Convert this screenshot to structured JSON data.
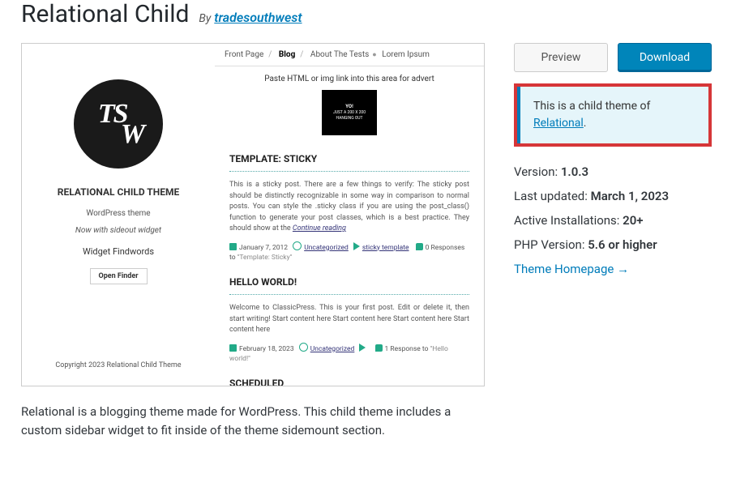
{
  "header": {
    "title": "Relational Child",
    "by": "By",
    "author": "tradesouthwest"
  },
  "screenshot": {
    "theme_name": "RELATIONAL CHILD THEME",
    "subtitle1": "WordPress theme",
    "subtitle2": "Now with sideout widget",
    "widget_label": "Widget Findwords",
    "open_finder": "Open Finder",
    "copyright": "Copyright 2023 Relational Child Theme",
    "nav": {
      "front": "Front Page",
      "blog": "Blog",
      "about": "About The Tests",
      "lorem": "Lorem Ipsum"
    },
    "ad_hint": "Paste HTML or img link into this area for advert",
    "ad_box": {
      "line1": "YO!",
      "line2": "JUST A 200 X 200",
      "line3": "HANGING OUT"
    },
    "post1": {
      "title": "TEMPLATE: STICKY",
      "body": "This is a sticky post. There are a few things to verify: The sticky post should be distinctly recognizable in some way in comparison to normal posts. You can style the .sticky class if you are using the post_class() function to generate your post classes, which is a best practice. They should show at the ",
      "continue": "Continue reading",
      "date": "January 7, 2012",
      "cat": "Uncategorized",
      "tags": "sticky template",
      "responses": "0 Responses to",
      "respto": "\"Template: Sticky\""
    },
    "post2": {
      "title": "HELLO WORLD!",
      "body": "Welcome to ClassicPress. This is your first post. Edit or delete it, then start writing! Start content here Start content here Start content here Start content here",
      "date": "February 18, 2023",
      "cat": "Uncategorized",
      "responses": "1 Response to",
      "respto": "\"Hello world!\""
    },
    "post3": {
      "title": "SCHEDULED"
    }
  },
  "description": "Relational is a blogging theme made for WordPress. This child theme includes a custom sidebar widget to fit inside of the theme sidemount section.",
  "actions": {
    "preview": "Preview",
    "download": "Download"
  },
  "notice": {
    "text": "This is a child theme of ",
    "link": "Relational",
    "suffix": "."
  },
  "meta": {
    "version_label": "Version: ",
    "version": "1.0.3",
    "updated_label": "Last updated: ",
    "updated": "March 1, 2023",
    "installs_label": "Active Installations: ",
    "installs": "20+",
    "php_label": "PHP Version: ",
    "php": "5.6 or higher",
    "homepage": "Theme Homepage",
    "arrow": "→"
  }
}
